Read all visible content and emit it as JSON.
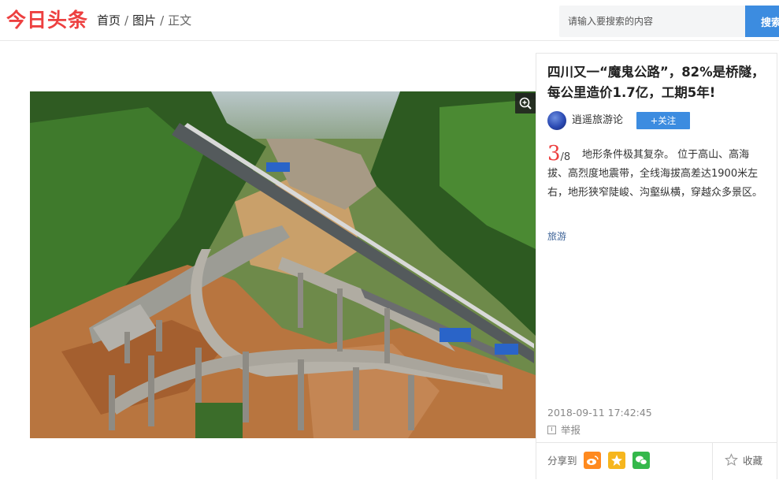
{
  "header": {
    "logo": "今日头条",
    "breadcrumb": [
      {
        "label": "首页"
      },
      {
        "label": "图片"
      },
      {
        "label": "正文"
      }
    ],
    "breadcrumb_separator": "/",
    "search_placeholder": "请输入要搜索的内容",
    "search_button": "搜索"
  },
  "article": {
    "title": "四川又一“魔鬼公路”，82%是桥隧，每公里造价1.7亿，工期5年!",
    "author": "逍遥旅游论",
    "follow_label": "+关注",
    "current_index": "3",
    "total": "/8",
    "description": "地形条件极其复杂。 位于高山、高海拔、高烈度地震带，全线海拔高差达1900米左右，地形狭窄陡峻、沟壑纵横，穿越众多景区。",
    "tag": "旅游",
    "datetime": "2018-09-11 17:42:45",
    "report_label": "举报"
  },
  "share": {
    "label": "分享到",
    "targets": [
      "weibo-icon",
      "qzone-icon",
      "wechat-icon"
    ],
    "favorite_label": "收藏"
  },
  "colors": {
    "brand_red": "#ed4040",
    "accent_blue": "#3c8ce0",
    "tag_blue": "#406599"
  }
}
